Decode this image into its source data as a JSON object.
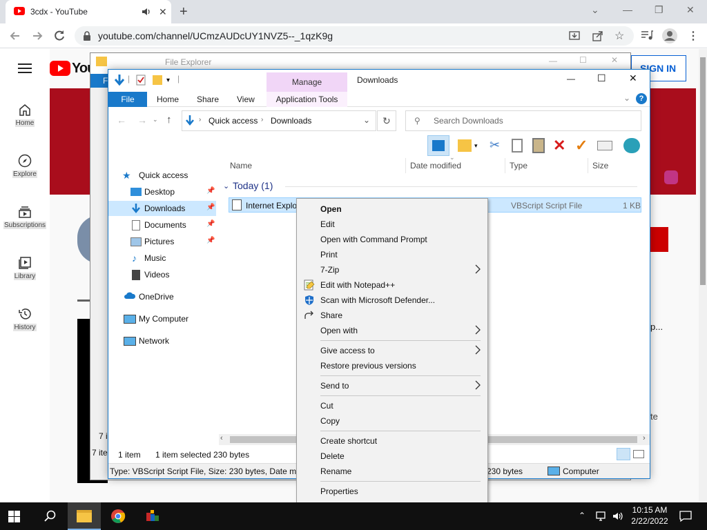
{
  "chrome": {
    "tab_title": "3cdx - YouTube",
    "url": "youtube.com/channel/UCmzAUDcUY1NVZ5--_1qzK9g"
  },
  "youtube": {
    "logo_text": "You",
    "signin": "SIGN IN",
    "subscribe_partial": "E",
    "nav": [
      {
        "label": "Home"
      },
      {
        "label": "Explore"
      },
      {
        "label": "Subscriptions"
      },
      {
        "label": "Library"
      },
      {
        "label": "History"
      }
    ],
    "fragments": {
      "banner_exclaim": "!",
      "video_title_partial": "p...",
      "side_text": "te",
      "count_a": "7 i",
      "count_b": "7 ite"
    }
  },
  "bg_explorer": {
    "title": "File Explorer",
    "file_tab_partial": "F"
  },
  "explorer": {
    "title": "Downloads",
    "manage": "Manage",
    "ribbon_tabs": {
      "file": "File",
      "home": "Home",
      "share": "Share",
      "view": "View",
      "app_tools": "Application Tools"
    },
    "breadcrumb": [
      "Quick access",
      "Downloads"
    ],
    "search_placeholder": "Search Downloads",
    "nav_items": [
      {
        "label": "Quick access"
      },
      {
        "label": "Desktop"
      },
      {
        "label": "Downloads"
      },
      {
        "label": "Documents"
      },
      {
        "label": "Pictures"
      },
      {
        "label": "Music"
      },
      {
        "label": "Videos"
      },
      {
        "label": "OneDrive"
      },
      {
        "label": "My Computer"
      },
      {
        "label": "Network"
      }
    ],
    "columns": {
      "name": "Name",
      "date": "Date modified",
      "type": "Type",
      "size": "Size"
    },
    "group": "Today (1)",
    "file": {
      "name": "Internet Explor",
      "type": "VBScript Script File",
      "size": "1 KB"
    },
    "status": {
      "count": "1 item",
      "selected": "1 item selected  230 bytes"
    },
    "details": {
      "text": "Type: VBScript Script File, Size: 230 bytes, Date modi",
      "bytes": "230 bytes",
      "location": "Computer"
    }
  },
  "context_menu": {
    "items": [
      {
        "label": "Open"
      },
      {
        "label": "Edit"
      },
      {
        "label": "Open with Command Prompt"
      },
      {
        "label": "Print"
      },
      {
        "label": "7-Zip"
      },
      {
        "label": "Edit with Notepad++"
      },
      {
        "label": "Scan with Microsoft Defender..."
      },
      {
        "label": "Share"
      },
      {
        "label": "Open with"
      },
      {
        "label": "Give access to"
      },
      {
        "label": "Restore previous versions"
      },
      {
        "label": "Send to"
      },
      {
        "label": "Cut"
      },
      {
        "label": "Copy"
      },
      {
        "label": "Create shortcut"
      },
      {
        "label": "Delete"
      },
      {
        "label": "Rename"
      },
      {
        "label": "Properties"
      }
    ]
  },
  "taskbar": {
    "time": "10:15 AM",
    "date": "2/22/2022"
  },
  "colors": {
    "youtube_red": "#ff0000",
    "explorer_blue": "#1979ca",
    "manage_purple": "#f1d6f7",
    "selection": "#cce8ff"
  }
}
